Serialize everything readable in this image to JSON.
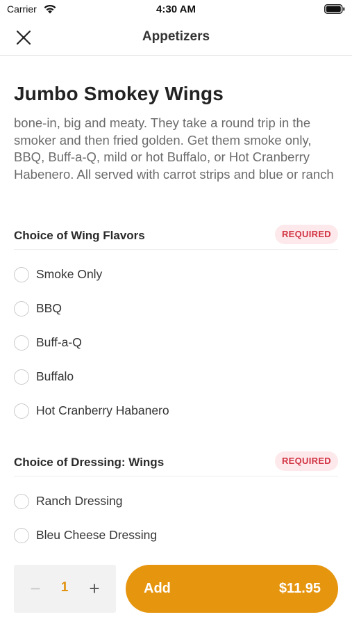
{
  "status_bar": {
    "carrier": "Carrier",
    "time": "4:30 AM",
    "icons": [
      "wifi-icon",
      "battery-icon"
    ]
  },
  "nav": {
    "title": "Appetizers",
    "close_icon": "close-icon"
  },
  "item": {
    "title": "Jumbo Smokey Wings",
    "description": "bone-in, big and meaty. They take a round trip in the smoker and then fried golden. Get them smoke only, BBQ, Buff-a-Q, mild or hot Buffalo, or Hot Cranberry Habenero. All served with carrot strips and blue or ranch"
  },
  "groups": [
    {
      "title": "Choice of Wing Flavors",
      "badge": "REQUIRED",
      "options": [
        "Smoke Only",
        "BBQ",
        "Buff-a-Q",
        "Buffalo",
        "Hot Cranberry Habanero"
      ]
    },
    {
      "title": "Choice of Dressing: Wings",
      "badge": "REQUIRED",
      "options": [
        "Ranch Dressing",
        "Bleu Cheese Dressing"
      ]
    }
  ],
  "footer": {
    "quantity": "1",
    "minus_label": "−",
    "plus_label": "+",
    "add_label": "Add",
    "price": "$11.95"
  },
  "colors": {
    "accent": "#e6950f",
    "badge_bg": "#fde9eb",
    "badge_text": "#d23343",
    "description_text": "#6b6b6b"
  }
}
